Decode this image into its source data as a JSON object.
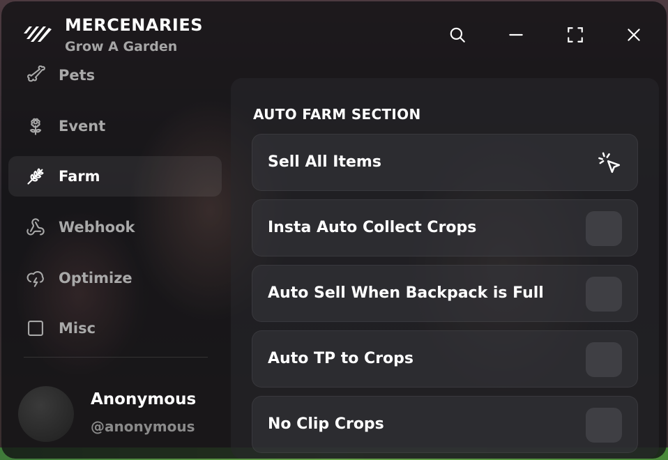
{
  "app": {
    "title": "MERCENARIES",
    "subtitle": "Grow A Garden"
  },
  "titlebar": {
    "icons": [
      "search-icon",
      "minimize-icon",
      "maximize-icon",
      "close-icon"
    ]
  },
  "sidebar": {
    "items": [
      {
        "label": "Pets",
        "icon": "bone-icon",
        "active": false
      },
      {
        "label": "Event",
        "icon": "flower-icon",
        "active": false
      },
      {
        "label": "Farm",
        "icon": "wheat-icon",
        "active": true
      },
      {
        "label": "Webhook",
        "icon": "webhook-icon",
        "active": false
      },
      {
        "label": "Optimize",
        "icon": "cloud-lightning-icon",
        "active": false
      },
      {
        "label": "Misc",
        "icon": "square-icon",
        "active": false
      }
    ]
  },
  "user": {
    "name": "Anonymous",
    "handle": "@anonymous"
  },
  "main": {
    "section_title": "AUTO FARM SECTION",
    "rows": [
      {
        "label": "Sell All Items",
        "type": "button",
        "icon": "pointer-click-icon"
      },
      {
        "label": "Insta Auto Collect Crops",
        "type": "toggle",
        "on": false
      },
      {
        "label": "Auto Sell When Backpack is Full",
        "type": "toggle",
        "on": false
      },
      {
        "label": "Auto TP to Crops",
        "type": "toggle",
        "on": false
      },
      {
        "label": "No Clip Crops",
        "type": "toggle",
        "on": false
      }
    ]
  },
  "colors": {
    "accent": "#ffffff",
    "muted_text": "#a9a9a9",
    "panel_bg": "#1c1c1f"
  }
}
